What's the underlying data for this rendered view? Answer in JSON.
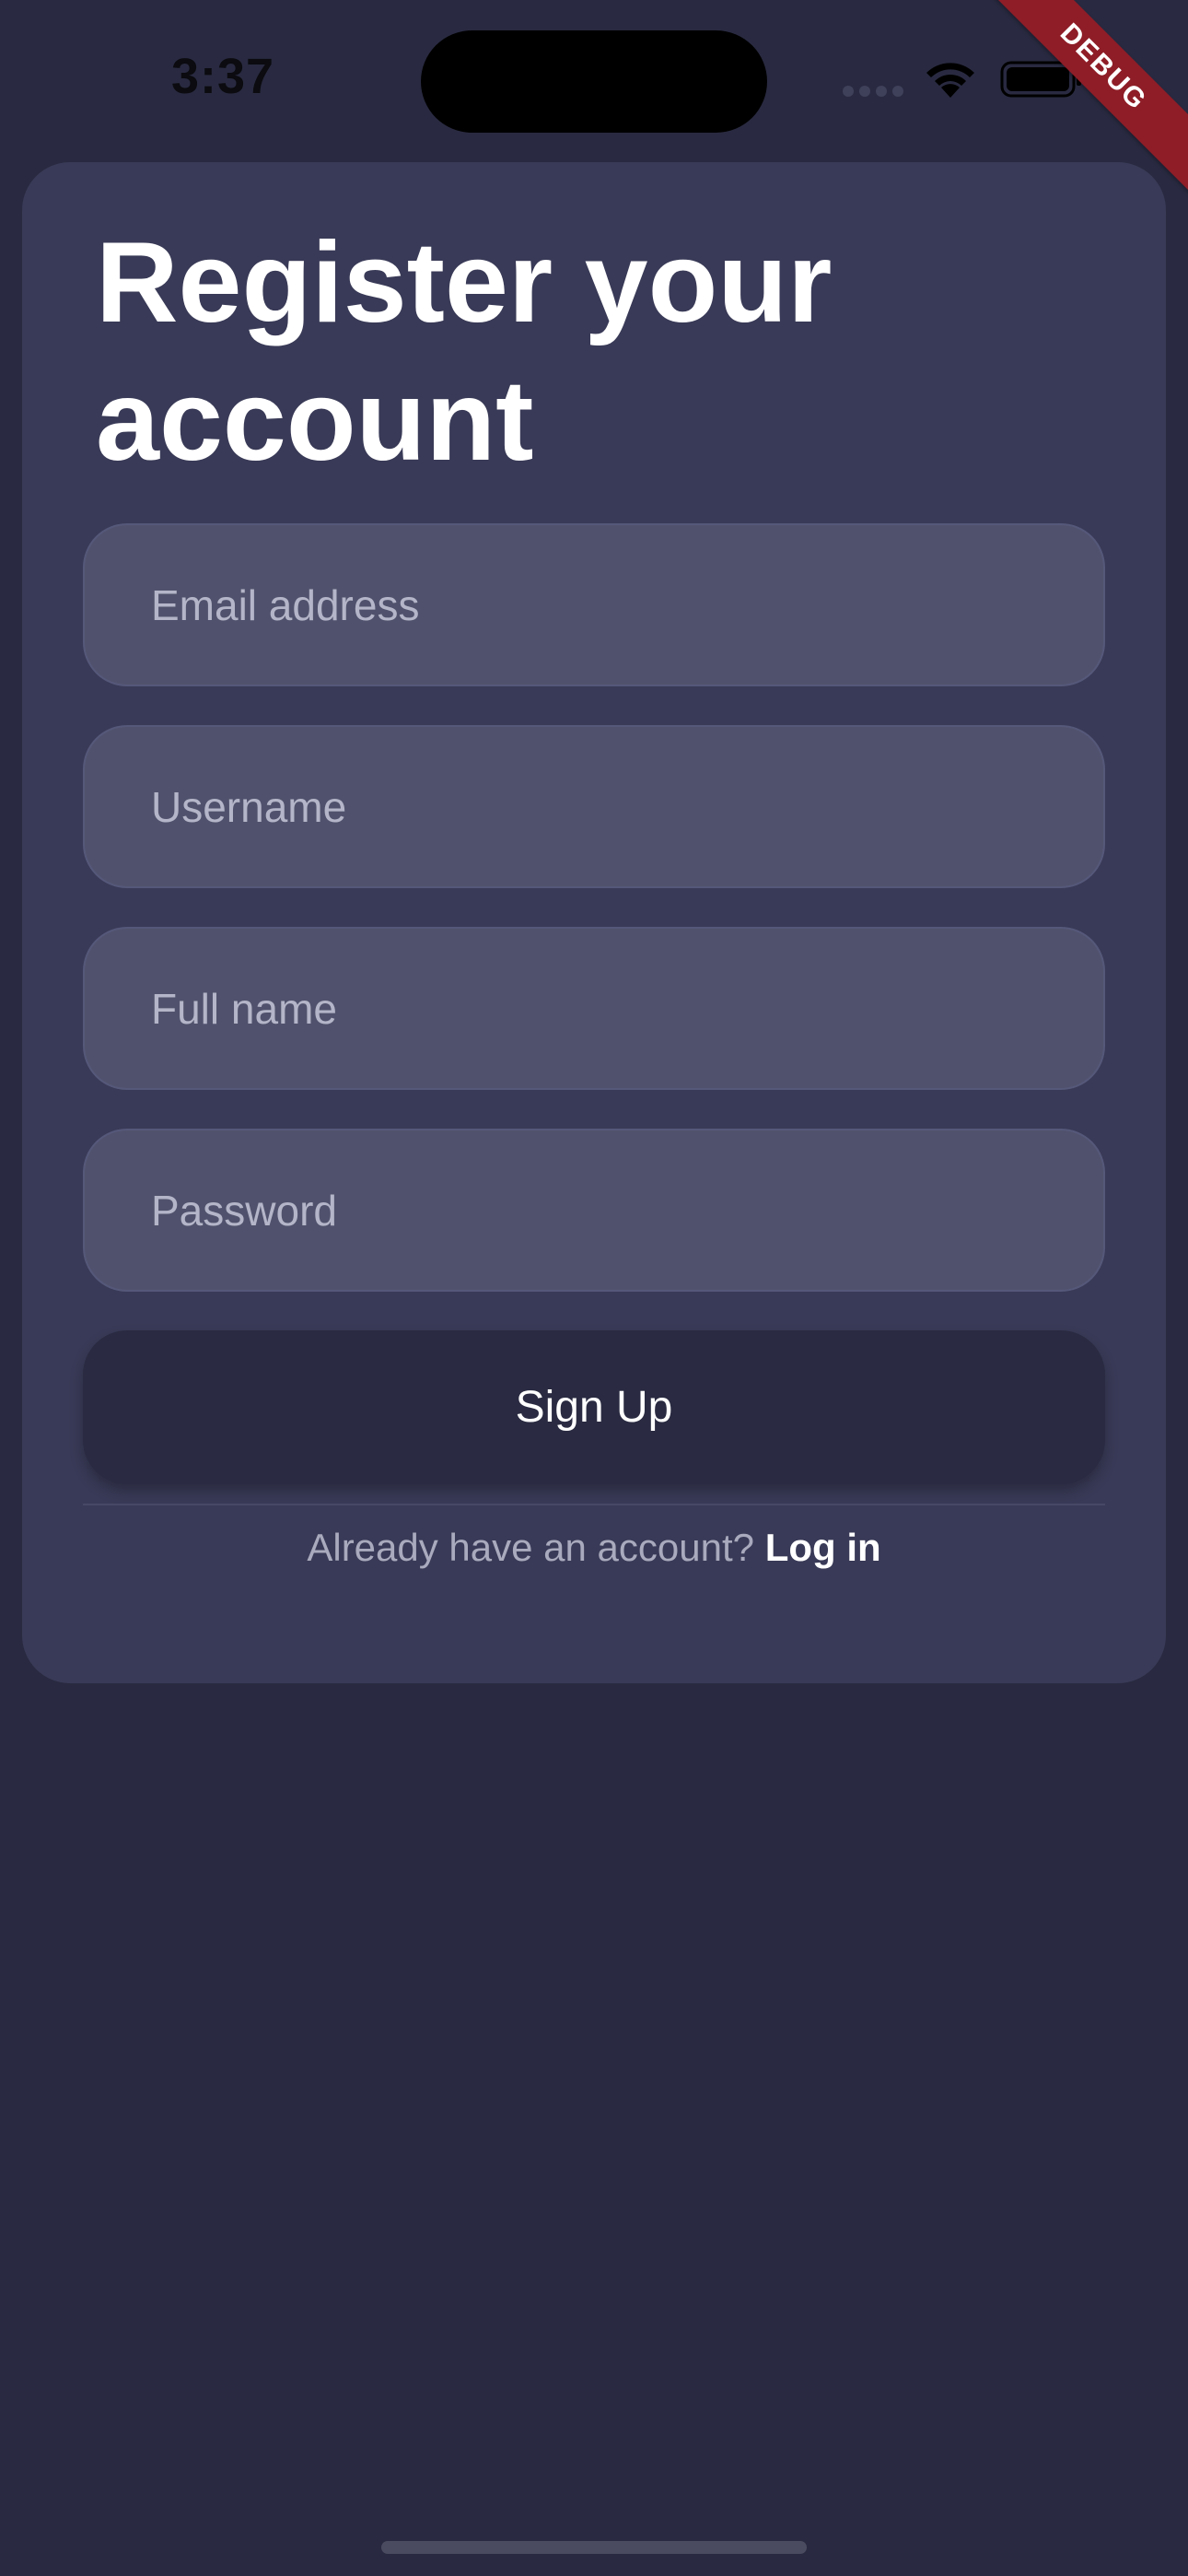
{
  "status_bar": {
    "time": "3:37"
  },
  "debug_banner": {
    "label": "DEBUG"
  },
  "form": {
    "title": "Register your account",
    "fields": {
      "email": {
        "placeholder": "Email address",
        "value": ""
      },
      "username": {
        "placeholder": "Username",
        "value": ""
      },
      "full_name": {
        "placeholder": "Full name",
        "value": ""
      },
      "password": {
        "placeholder": "Password",
        "value": ""
      }
    },
    "submit_label": "Sign Up",
    "login_prompt": "Already have an account?",
    "login_link": "Log in"
  },
  "colors": {
    "background": "#292a41",
    "card": "#393a57",
    "field": "#50526d",
    "button": "#2a2b42",
    "debug_banner": "#8e1d27"
  }
}
